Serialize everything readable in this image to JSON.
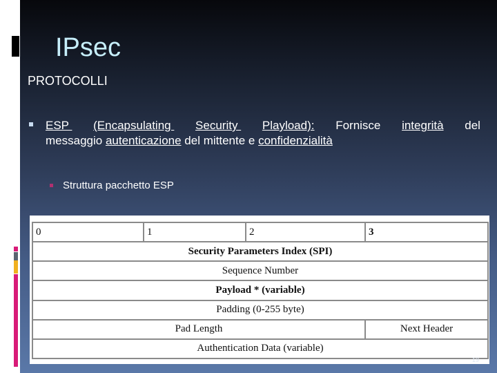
{
  "slide": {
    "title": "IPsec",
    "subtitle": "PROTOCOLLI",
    "paragraph": {
      "line1": [
        {
          "text": "ESP ",
          "underline": true
        },
        {
          "text": "(Encapsulating ",
          "underline": true
        },
        {
          "text": "Security ",
          "underline": true
        },
        {
          "text": "Playload):",
          "underline": true
        },
        {
          "text": "Fornisce",
          "underline": false
        },
        {
          "text": "integrità",
          "underline": true
        },
        {
          "text": "del",
          "underline": false
        }
      ],
      "line2": {
        "part1": "messaggio ",
        "part2": "autenticazione",
        "part3": " del mittente e ",
        "part4": "confidenzialità"
      }
    },
    "sub_item": "Struttura pacchetto ESP",
    "page_number": "19"
  },
  "colors": {
    "title": "#c6eefa",
    "bullet_primary": "#c8dcf0",
    "bullet_secondary": "#b03070",
    "deco_magenta": "#d81b78",
    "deco_gray": "#5a6470",
    "deco_amber": "#f0b020"
  },
  "esp_table": {
    "header": [
      "0",
      "1",
      "2",
      "3"
    ],
    "rows": [
      "Security Parameters Index (SPI)",
      "Sequence Number",
      "Payload * (variable)",
      "Padding (0-255 byte)"
    ],
    "split_row": {
      "left": "Pad Length",
      "right": "Next Header"
    },
    "last_row": "Authentication Data (variable)"
  }
}
